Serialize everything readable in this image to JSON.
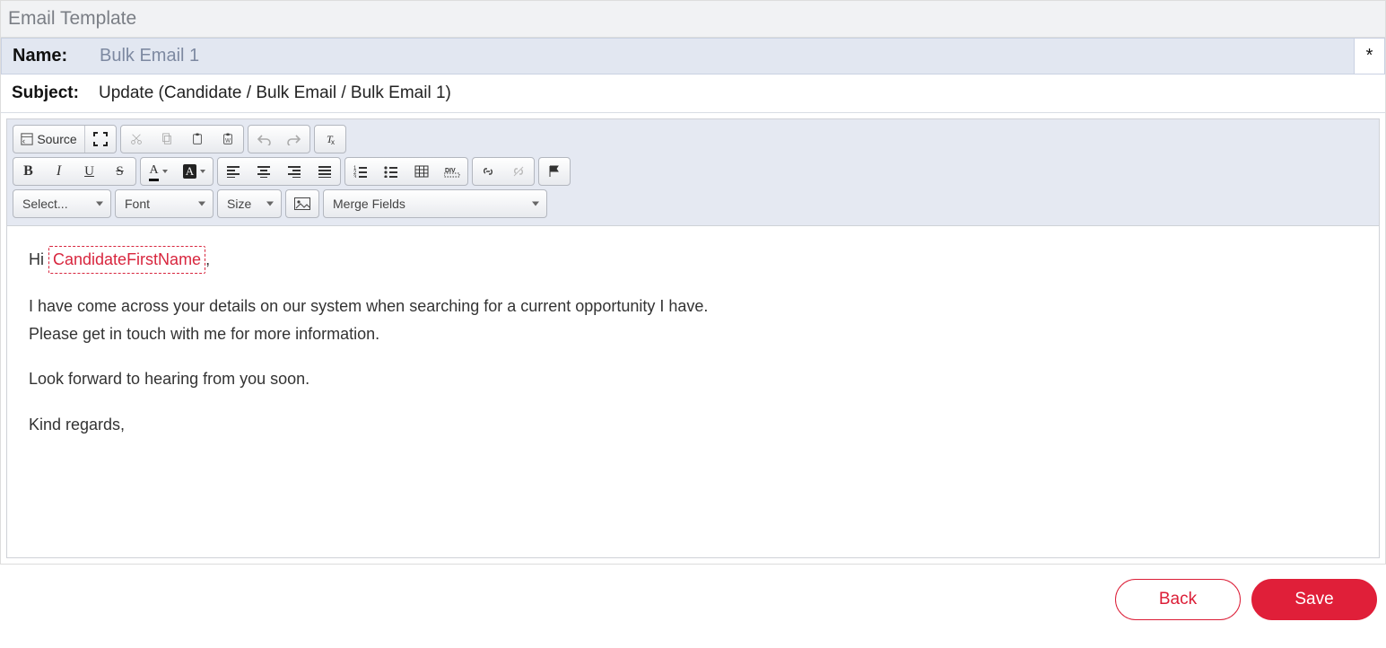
{
  "header": {
    "title": "Email Template"
  },
  "fields": {
    "name_label": "Name:",
    "name_value": "Bulk Email 1",
    "required_marker": "*",
    "subject_label": "Subject:",
    "subject_value": "Update (Candidate / Bulk Email / Bulk Email 1)"
  },
  "toolbar": {
    "source_label": "Source",
    "select_style": "Select...",
    "font": "Font",
    "size": "Size",
    "merge_fields": "Merge Fields"
  },
  "body": {
    "greeting_prefix": "Hi ",
    "merge_token": "CandidateFirstName",
    "greeting_suffix": ",",
    "p1": "I have come across your details on our system when searching for a current opportunity I have.",
    "p2": "Please get in touch with me for more information.",
    "p3": "Look forward to hearing from you soon.",
    "p4": "Kind regards,"
  },
  "footer": {
    "back": "Back",
    "save": "Save"
  }
}
